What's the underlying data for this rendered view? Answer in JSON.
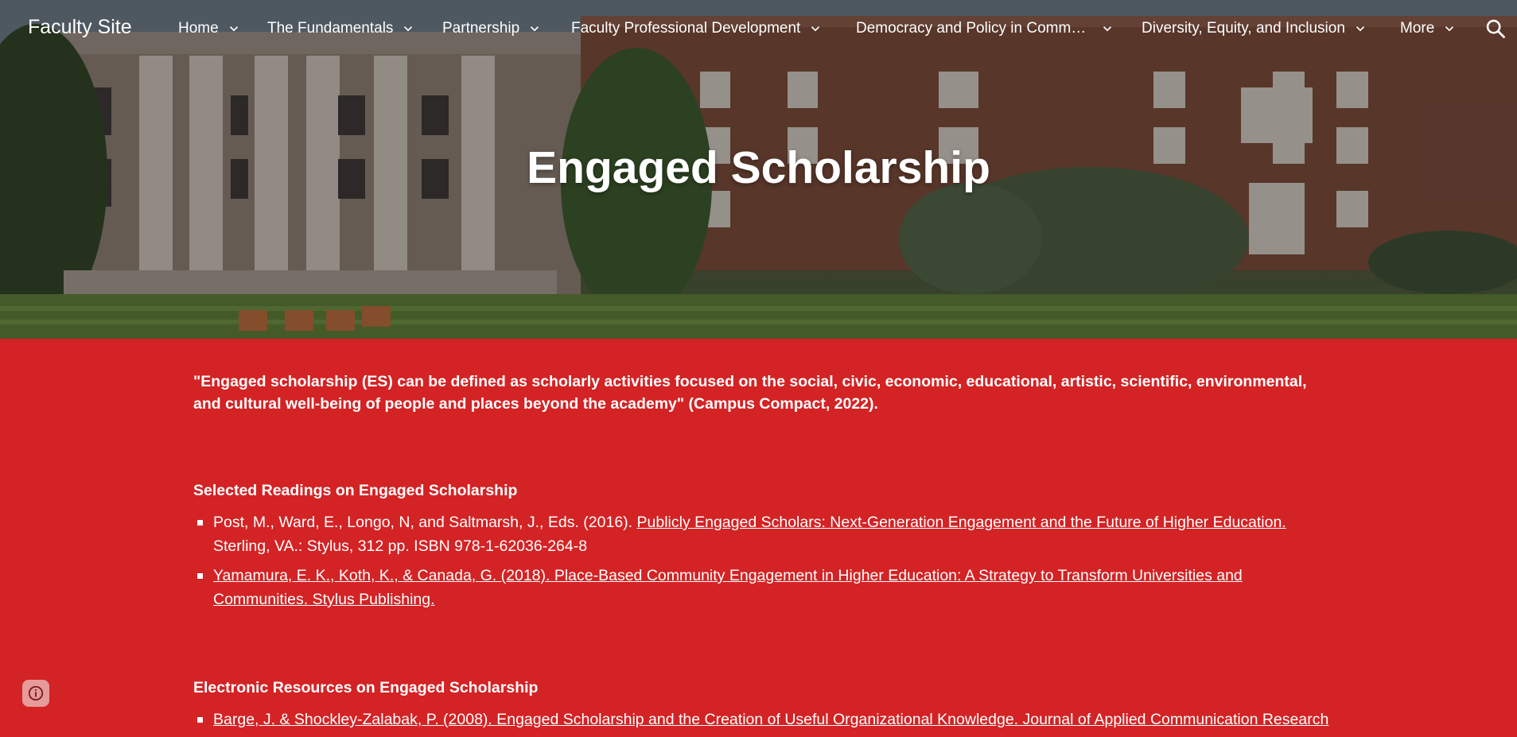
{
  "site": {
    "title": "Faculty Site"
  },
  "nav": {
    "items": [
      {
        "label": "Home"
      },
      {
        "label": "The Fundamentals"
      },
      {
        "label": "Partnership"
      },
      {
        "label": "Faculty Professional Development"
      },
      {
        "label": "Democracy and Policy in Comm…"
      },
      {
        "label": "Diversity, Equity, and Inclusion"
      },
      {
        "label": "More"
      }
    ],
    "search_icon": "search-icon"
  },
  "hero": {
    "title": "Engaged Scholarship"
  },
  "colors": {
    "accent": "#d32325",
    "text": "#ffffff"
  },
  "main": {
    "quote": "\"Engaged scholarship (ES) can be defined as scholarly activities focused on the social, civic, economic, educational, artistic, scientific, environmental, and cultural well-being of people and places beyond the academy\" (Campus Compact, 2022).",
    "readings": {
      "heading": "Selected Readings on Engaged Scholarship",
      "items": [
        {
          "prefix": "Post, M., Ward, E., Longo, N, and Saltmarsh, J., Eds. (2016). ",
          "link": "Publicly Engaged Scholars: Next-Generation Engagement and the Future of Higher Education.",
          "suffix": " Sterling, VA.: Stylus, 312 pp. ISBN 978-1-62036-264-8"
        },
        {
          "prefix": "",
          "link": "Yamamura, E. K., Koth, K., & Canada, G. (2018). Place-Based Community Engagement in Higher Education: A Strategy to Transform Universities and Communities. Stylus Publishing.",
          "suffix": ""
        }
      ]
    },
    "electronic": {
      "heading": "Electronic Resources on Engaged Scholarship",
      "items": [
        {
          "prefix": "",
          "link": "Barge, J. & Shockley-Zalabak, P. (2008). Engaged Scholarship and the Creation of Useful Organizational Knowledge. Journal of Applied Communication Research",
          "suffix": ""
        }
      ]
    }
  },
  "footer": {
    "info_icon": "info-icon"
  }
}
